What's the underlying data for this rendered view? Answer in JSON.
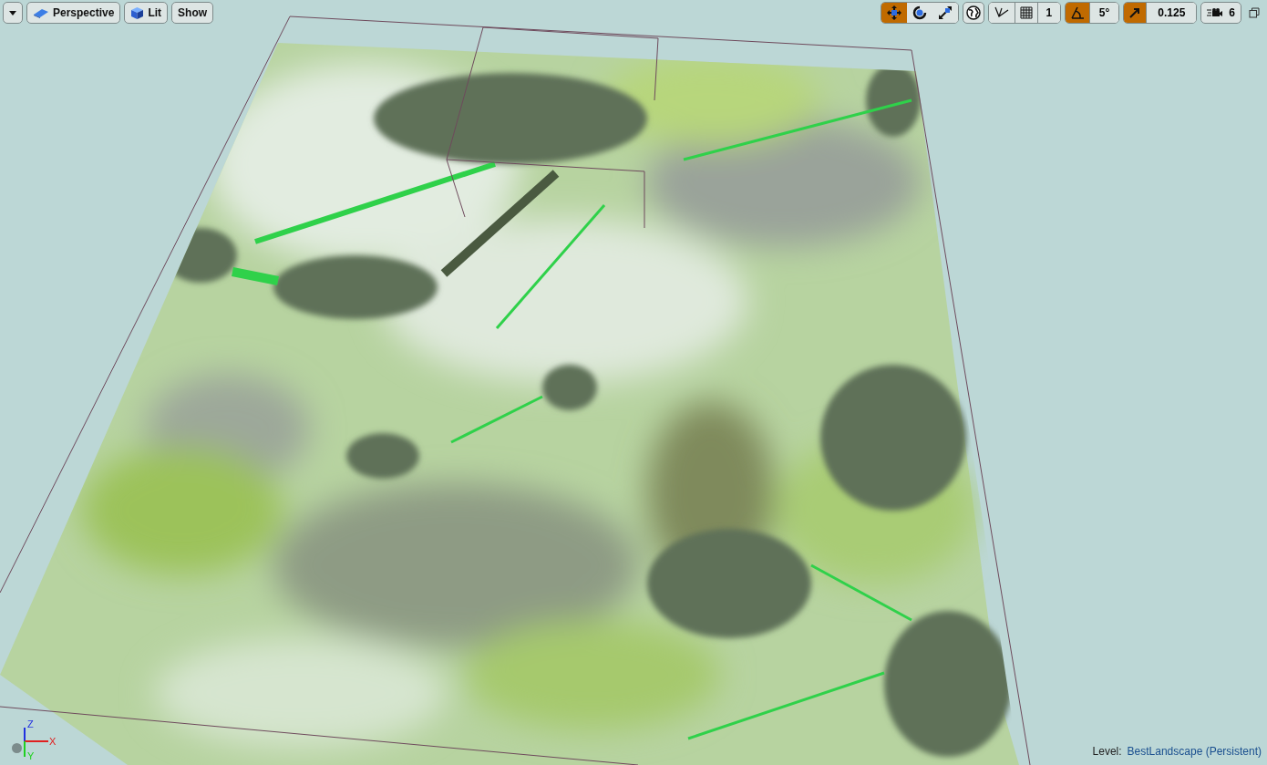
{
  "toolbar_left": {
    "perspective": "Perspective",
    "view_mode": "Lit",
    "show": "Show"
  },
  "toolbar_right": {
    "transform_modes": [
      {
        "kind": "translate",
        "selected": true
      },
      {
        "kind": "rotate",
        "selected": false
      },
      {
        "kind": "scale",
        "selected": false
      }
    ],
    "grid_snap": {
      "on": false,
      "value": "1"
    },
    "rotation_snap": {
      "on": true,
      "value": "5°"
    },
    "scale_snap": {
      "on": true,
      "value": "0.125"
    },
    "camera_speed": "6"
  },
  "axis_gizmo": {
    "z": "Z",
    "x": "X",
    "y": "Y"
  },
  "level": {
    "label": "Level:",
    "name": "BestLandscape (Persistent)"
  }
}
